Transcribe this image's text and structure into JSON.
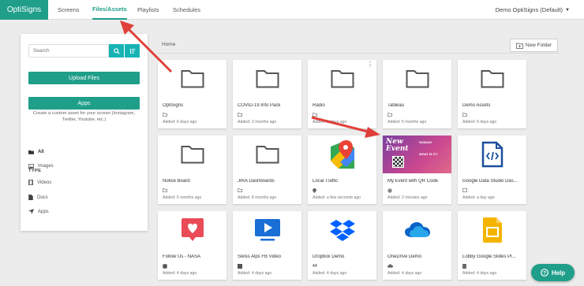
{
  "nav": {
    "logo": "OptiSigns",
    "tabs": [
      {
        "label": "Screens"
      },
      {
        "label": "Files/Assets"
      },
      {
        "label": "Playlists"
      },
      {
        "label": "Schedules"
      }
    ],
    "account": "Demo OptiSigns (Default)"
  },
  "sidebar": {
    "search_placeholder": "Search",
    "upload_label": "Upload Files",
    "apps_label": "Apps",
    "apps_description": "Create a custom asset for your screen (Instagram, Twitter, Youtube, etc.)",
    "type_label": "TYPE",
    "types": [
      {
        "label": "All",
        "icon": "folder-icon"
      },
      {
        "label": "Images",
        "icon": "image-icon"
      },
      {
        "label": "Videos",
        "icon": "film-icon"
      },
      {
        "label": "Docs",
        "icon": "document-icon"
      },
      {
        "label": "Apps",
        "icon": "send-icon"
      }
    ]
  },
  "main": {
    "breadcrumb": "Home",
    "new_folder_label": "New Folder",
    "cards": [
      {
        "title": "OptiSigns",
        "date": "Added: 6 days ago",
        "kind": "folder"
      },
      {
        "title": "COVID-19 Info Pack",
        "date": "Added: 3 months ago",
        "kind": "folder"
      },
      {
        "title": "Radio",
        "date": "Added: 5 days ago",
        "kind": "folder"
      },
      {
        "title": "Tableau",
        "date": "Added: 5 months ago",
        "kind": "folder"
      },
      {
        "title": "Demo Assets",
        "date": "Added: 6 days ago",
        "kind": "folder"
      },
      {
        "title": "Notice Board",
        "date": "Added: 6 months ago",
        "kind": "folder"
      },
      {
        "title": "JIRA Dashboards",
        "date": "Added: 8 months ago",
        "kind": "folder"
      },
      {
        "title": "Local Traffic",
        "date": "Added: a few seconds ago",
        "kind": "maps"
      },
      {
        "title": "My Event with QR Code",
        "date": "Added: 2 minutes ago",
        "kind": "event"
      },
      {
        "title": "Google Data Studio Das...",
        "date": "Added: a day ago",
        "kind": "code-doc"
      },
      {
        "title": "Follow Us - NASA",
        "date": "Added: 4 days ago",
        "kind": "instagram"
      },
      {
        "title": "Swiss Alps FB Video",
        "date": "Added: 4 days ago",
        "kind": "video"
      },
      {
        "title": "Dropbox Demo",
        "date": "Added: 4 days ago",
        "kind": "dropbox"
      },
      {
        "title": "OneDrive Demo",
        "date": "Added: 4 days ago",
        "kind": "onedrive"
      },
      {
        "title": "Lobby Google Slides Pr...",
        "date": "Added: 4 days ago",
        "kind": "slides"
      }
    ],
    "event_thumb": {
      "line1": "New",
      "line2": "Event",
      "right1": "SUNDAY",
      "right2": "WHAT IS IT?"
    }
  },
  "help_label": "Help",
  "colors": {
    "brand": "#1f9e8a",
    "search_button": "#17b3b3",
    "annotation_arrow": "#e0403a"
  }
}
